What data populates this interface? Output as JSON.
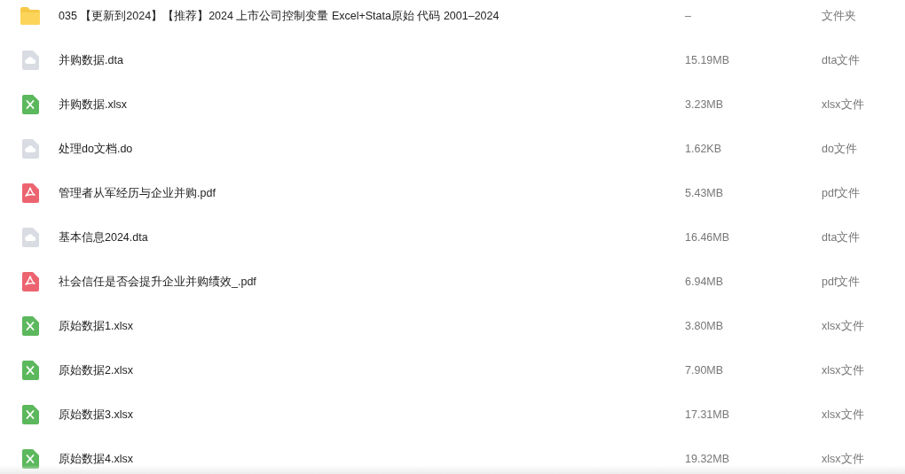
{
  "files": [
    {
      "kind": "folder",
      "name": "035 【更新到2024】【推荐】2024 上市公司控制变量 Excel+Stata原始 代码 2001–2024",
      "size": "–",
      "type": "文件夹"
    },
    {
      "kind": "generic",
      "name": "并购数据.dta",
      "size": "15.19MB",
      "type": "dta文件"
    },
    {
      "kind": "excel",
      "name": "并购数据.xlsx",
      "size": "3.23MB",
      "type": "xlsx文件"
    },
    {
      "kind": "generic",
      "name": "处理do文档.do",
      "size": "1.62KB",
      "type": "do文件"
    },
    {
      "kind": "pdf",
      "name": "管理者从军经历与企业并购.pdf",
      "size": "5.43MB",
      "type": "pdf文件"
    },
    {
      "kind": "generic",
      "name": "基本信息2024.dta",
      "size": "16.46MB",
      "type": "dta文件"
    },
    {
      "kind": "pdf",
      "name": "社会信任是否会提升企业并购绩效_.pdf",
      "size": "6.94MB",
      "type": "pdf文件"
    },
    {
      "kind": "excel",
      "name": "原始数据1.xlsx",
      "size": "3.80MB",
      "type": "xlsx文件"
    },
    {
      "kind": "excel",
      "name": "原始数据2.xlsx",
      "size": "7.90MB",
      "type": "xlsx文件"
    },
    {
      "kind": "excel",
      "name": "原始数据3.xlsx",
      "size": "17.31MB",
      "type": "xlsx文件"
    },
    {
      "kind": "excel",
      "name": "原始数据4.xlsx",
      "size": "19.32MB",
      "type": "xlsx文件"
    }
  ]
}
